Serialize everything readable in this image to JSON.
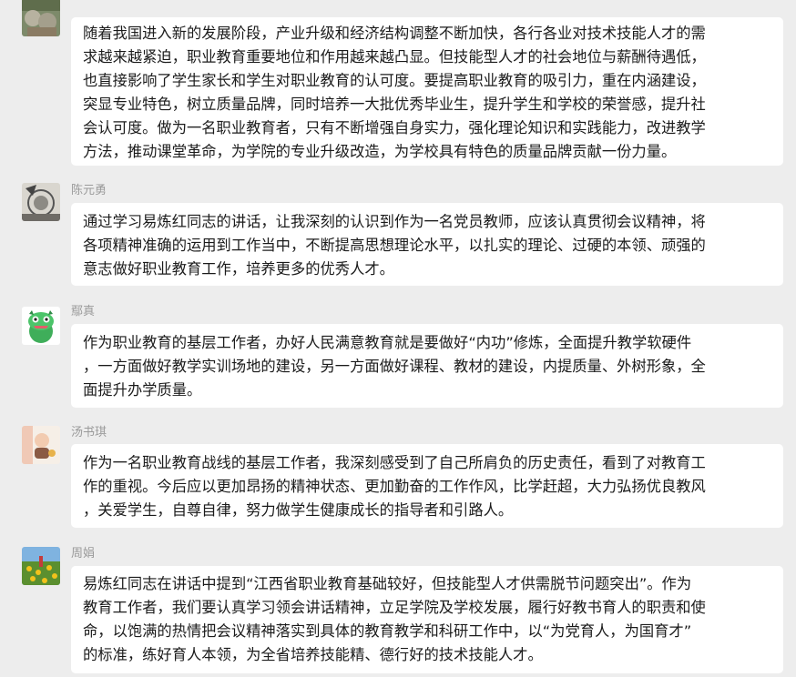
{
  "messages": [
    {
      "sender": "",
      "avatar_icon": "stone-ornament-photo",
      "lines": [
        "随着我国进入新的发展阶段，产业升级和经济结构调整不断加快，各行各业对技术技能人才的需",
        "求越来越紧迫，职业教育重要地位和作用越来越凸显。但技能型人才的社会地位与薪酬待遇低，",
        "也直接影响了学生家长和学生对职业教育的认可度。要提高职业教育的吸引力，重在内涵建设，",
        "突显专业特色，树立质量品牌，同时培养一大批优秀毕业生，提升学生和学校的荣誉感，提升社",
        "会认可度。做为一名职业教育者，只有不断增强自身实力，强化理论知识和实践能力，改进教学",
        "方法，推动课堂革命，为学院的专业升级改造，为学校具有特色的质量品牌贡献一份力量。"
      ]
    },
    {
      "sender": "陈元勇",
      "avatar_icon": "sketch-portrait-photo",
      "lines": [
        "通过学习易炼红同志的讲话，让我深刻的认识到作为一名党员教师，应该认真贯彻会议精神，将",
        "各项精神准确的运用到工作当中，不断提高思想理论水平，以扎实的理论、过硬的本领、顽强的",
        "意志做好职业教育工作，培养更多的优秀人才。"
      ]
    },
    {
      "sender": "鄢真",
      "avatar_icon": "green-dinosaur-avatar",
      "lines": [
        "作为职业教育的基层工作者，办好人民满意教育就是要做好“内功”修炼，全面提升教学软硬件",
        "，一方面做好教学实训场地的建设，另一方面做好课程、教材的建设，内提质量、外树形象，全",
        "面提升办学质量。"
      ]
    },
    {
      "sender": "汤书琪",
      "avatar_icon": "baby-photo",
      "lines": [
        "作为一名职业教育战线的基层工作者，我深刻感受到了自己所肩负的历史责任，看到了对教育工",
        "作的重视。今后应以更加昂扬的精神状态、更加勤奋的工作作风，比学赶超，大力弘扬优良教风",
        "，关爱学生，自尊自律，努力做学生健康成长的指导者和引路人。"
      ]
    },
    {
      "sender": "周娟",
      "avatar_icon": "sunflower-field-photo",
      "lines": [
        "易炼红同志在讲话中提到“江西省职业教育基础较好，但技能型人才供需脱节问题突出”。作为",
        "教育工作者，我们要认真学习领会讲话精神，立足学院及学校发展，履行好教书育人的职责和使",
        "命，以饱满的热情把会议精神落实到具体的教育教学和科研工作中，以“为党育人，为国育才”",
        "的标准，练好育人本领，为全省培养技能精、德行好的技术技能人才。"
      ]
    }
  ]
}
